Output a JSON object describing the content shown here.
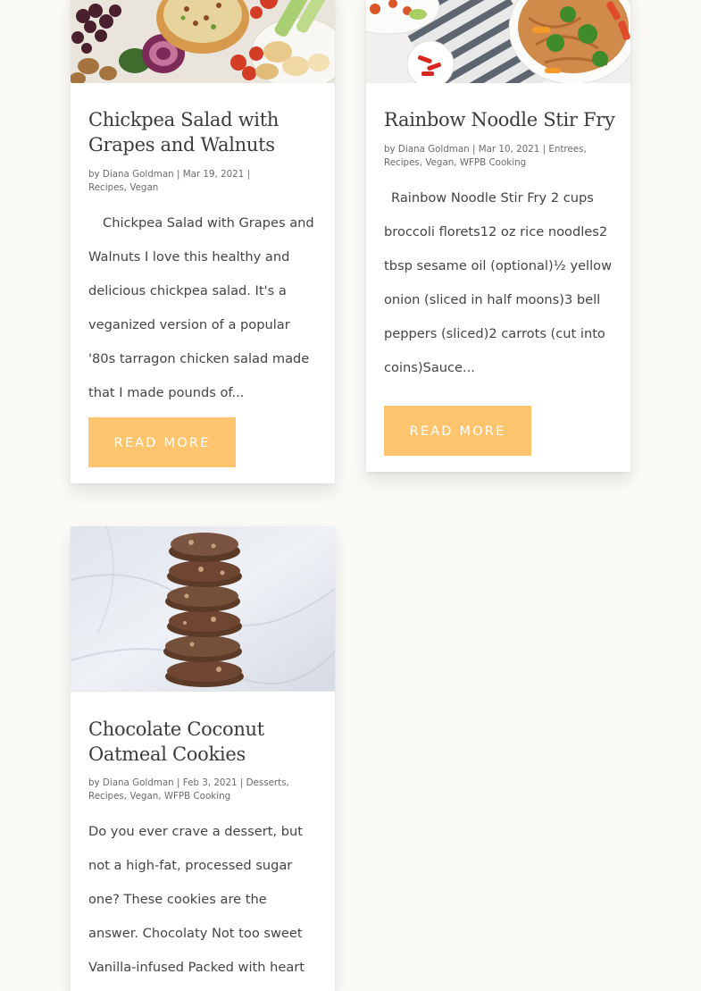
{
  "posts": [
    {
      "title": "Chickpea Salad with Grapes and Walnuts",
      "meta": {
        "by": "by",
        "author": "Diana Goldman",
        "sep": "|",
        "date": "Mar 19, 2021",
        "categories": "Recipes, Vegan"
      },
      "excerpt": "Chickpea Salad with Grapes and Walnuts I love this healthy and delicious chickpea salad. It's a veganized version of a popular '80s tarragon chicken salad made that I made pounds of...",
      "read_more": "READ MORE"
    },
    {
      "title": "Rainbow Noodle Stir Fry",
      "meta": {
        "by": "by",
        "author": "Diana Goldman",
        "sep": "|",
        "date": "Mar 10, 2021",
        "categories": "Entrees, Recipes, Vegan, WFPB Cooking"
      },
      "excerpt": "Rainbow Noodle Stir Fry 2 cups broccoli florets12 oz rice noodles2 tbsp sesame oil (optional)½ yellow onion (sliced in half moons)3 bell peppers (sliced)2 carrots (cut into coins)Sauce...",
      "read_more": "READ MORE"
    },
    {
      "title": "Chocolate Coconut Oatmeal Cookies",
      "meta": {
        "by": "by",
        "author": "Diana Goldman",
        "sep": "|",
        "date": "Feb 3, 2021",
        "categories": "Desserts, Recipes, Vegan, WFPB Cooking"
      },
      "excerpt": "Do you ever crave a dessert, but not a high-fat, processed sugar one? These cookies are the answer. Chocolaty Not too sweet Vanilla-infused Packed with heart healthy oats Flavored with"
    }
  ],
  "colors": {
    "button": "#ffc46e",
    "page_bg": "#fbfaf7",
    "title": "#3b3b3b"
  }
}
